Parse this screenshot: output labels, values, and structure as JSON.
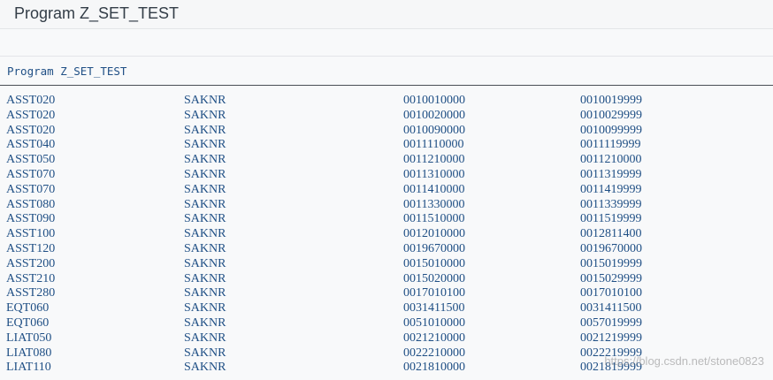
{
  "window": {
    "title": "Program Z_SET_TEST"
  },
  "list": {
    "header": "Program Z_SET_TEST",
    "rows": [
      {
        "set": "ASST020",
        "field": "SAKNR",
        "from": "0010010000",
        "to": "0010019999"
      },
      {
        "set": "ASST020",
        "field": "SAKNR",
        "from": "0010020000",
        "to": "0010029999"
      },
      {
        "set": "ASST020",
        "field": "SAKNR",
        "from": "0010090000",
        "to": "0010099999"
      },
      {
        "set": "ASST040",
        "field": "SAKNR",
        "from": "0011110000",
        "to": "0011119999"
      },
      {
        "set": "ASST050",
        "field": "SAKNR",
        "from": "0011210000",
        "to": "0011210000"
      },
      {
        "set": "ASST070",
        "field": "SAKNR",
        "from": "0011310000",
        "to": "0011319999"
      },
      {
        "set": "ASST070",
        "field": "SAKNR",
        "from": "0011410000",
        "to": "0011419999"
      },
      {
        "set": "ASST080",
        "field": "SAKNR",
        "from": "0011330000",
        "to": "0011339999"
      },
      {
        "set": "ASST090",
        "field": "SAKNR",
        "from": "0011510000",
        "to": "0011519999"
      },
      {
        "set": "ASST100",
        "field": "SAKNR",
        "from": "0012010000",
        "to": "0012811400"
      },
      {
        "set": "ASST120",
        "field": "SAKNR",
        "from": "0019670000",
        "to": "0019670000"
      },
      {
        "set": "ASST200",
        "field": "SAKNR",
        "from": "0015010000",
        "to": "0015019999"
      },
      {
        "set": "ASST210",
        "field": "SAKNR",
        "from": "0015020000",
        "to": "0015029999"
      },
      {
        "set": "ASST280",
        "field": "SAKNR",
        "from": "0017010100",
        "to": "0017010100"
      },
      {
        "set": "EQT060",
        "field": "SAKNR",
        "from": "0031411500",
        "to": "0031411500"
      },
      {
        "set": "EQT060",
        "field": "SAKNR",
        "from": "0051010000",
        "to": "0057019999"
      },
      {
        "set": "LIAT050",
        "field": "SAKNR",
        "from": "0021210000",
        "to": "0021219999"
      },
      {
        "set": "LIAT080",
        "field": "SAKNR",
        "from": "0022210000",
        "to": "0022219999"
      },
      {
        "set": "LIAT110",
        "field": "SAKNR",
        "from": "0021810000",
        "to": "0021819999"
      }
    ]
  },
  "watermark": "https://blog.csdn.net/stone0823"
}
